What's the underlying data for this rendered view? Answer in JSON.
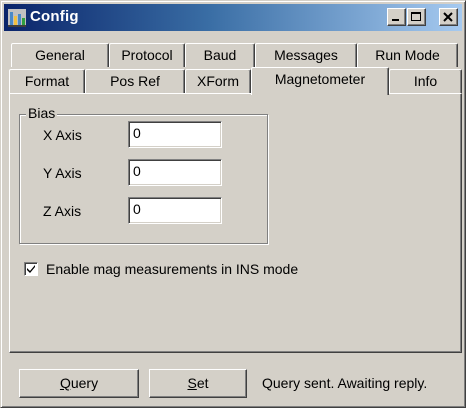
{
  "window": {
    "title": "Config",
    "icon": "app-chart-icon",
    "controls": [
      "minimize-icon",
      "maximize-icon",
      "close-icon"
    ]
  },
  "tabs": {
    "row1": [
      "General",
      "Protocol",
      "Baud",
      "Messages",
      "Run Mode"
    ],
    "row2": [
      "Format",
      "Pos Ref",
      "XForm",
      "Magnetometer",
      "Info"
    ],
    "active": "Magnetometer"
  },
  "bias": {
    "group_label": "Bias",
    "x_label": "X Axis",
    "x_value": "0",
    "y_label": "Y Axis",
    "y_value": "0",
    "z_label": "Z Axis",
    "z_value": "0"
  },
  "enable_mag": {
    "label": "Enable mag measurements in INS mode",
    "checked": true
  },
  "footer": {
    "query_accel": "Q",
    "query_rest": "uery",
    "set_accel": "S",
    "set_rest": "et",
    "status": "Query sent. Awaiting reply."
  },
  "colors": {
    "face": "#d4d0c8",
    "title_start": "#0a246a",
    "title_end": "#a6caf0"
  }
}
